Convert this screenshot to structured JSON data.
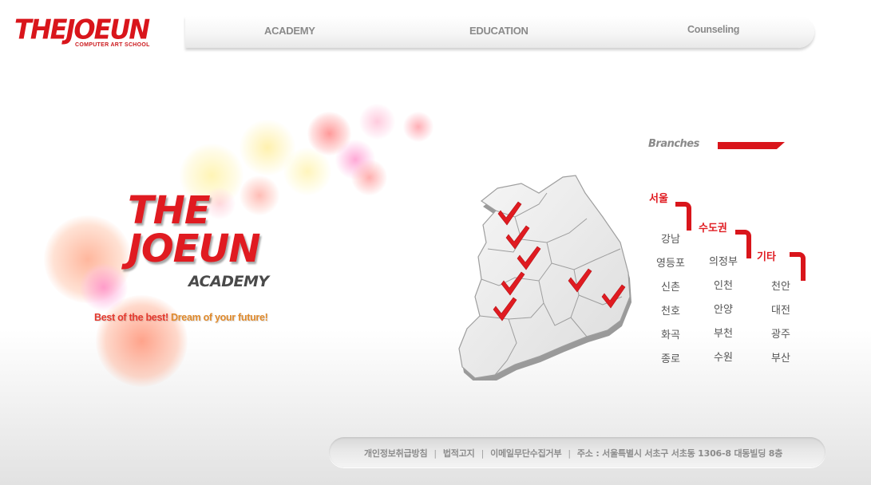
{
  "header": {
    "logo_main": "THEJOEUN",
    "logo_sub": "COMPUTER ART SCHOOL",
    "nav": [
      "ACADEMY",
      "EDUCATION",
      "Counseling"
    ]
  },
  "hero": {
    "logo_line1": "THE",
    "logo_line2": "JOEUN",
    "logo_sub": "ACADEMY",
    "slogan_part1": "Best of the best!",
    "slogan_part2": "Dream of your future!"
  },
  "branches": {
    "title": "Branches",
    "regions": [
      {
        "label": "서울",
        "items": [
          "강남",
          "영등포",
          "신촌",
          "천호",
          "화곡",
          "종로"
        ]
      },
      {
        "label": "수도권",
        "items": [
          "의정부",
          "인천",
          "안양",
          "부천",
          "수원"
        ]
      },
      {
        "label": "기타",
        "items": [
          "천안",
          "대전",
          "광주",
          "부산"
        ]
      }
    ]
  },
  "footer": {
    "links": [
      "개인정보취급방침",
      "법적고지",
      "이메일무단수집거부"
    ],
    "address": "주소 : 서울특별시 서초구 서초동 1306-8 대동빌딩 8층"
  },
  "colors": {
    "brand_red": "#d9151b",
    "nav_text": "#8a8a8a",
    "slogan_red": "#e5392e",
    "slogan_orange": "#e08a2c"
  }
}
